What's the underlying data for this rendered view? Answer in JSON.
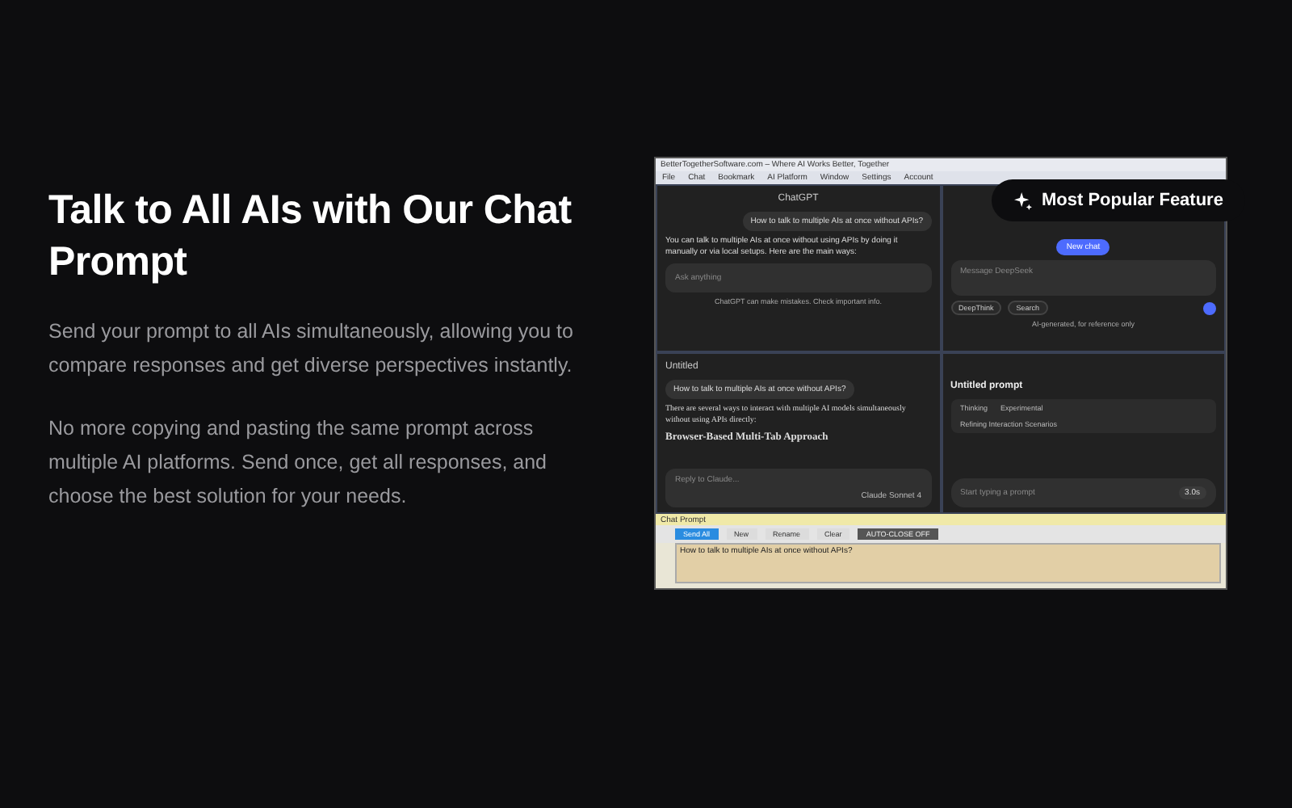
{
  "hero": {
    "title": "Talk to All AIs with Our Chat Prompt",
    "paragraphs": [
      "Send your prompt to all AIs simultaneously, allowing you to compare responses and get diverse perspectives instantly.",
      "No more copying and pasting the same prompt across multiple AI platforms. Send once, get all responses, and choose the best solution for your needs."
    ]
  },
  "badge": {
    "label": "Most Popular Feature"
  },
  "app_window": {
    "title": "BetterTogetherSoftware.com – Where AI Works Better, Together",
    "menu": [
      "File",
      "Chat",
      "Bookmark",
      "AI Platform",
      "Window",
      "Settings",
      "Account"
    ]
  },
  "chatgpt_pane": {
    "header": "ChatGPT",
    "user_message": "How to talk to multiple AIs at once without APIs?",
    "reply": "You can talk to multiple AIs at once without using APIs by doing it manually or via local setups. Here are the main ways:",
    "placeholder": "Ask anything",
    "footer": "ChatGPT can make mistakes. Check important info."
  },
  "deepseek_pane": {
    "new_chat": "New chat",
    "placeholder": "Message DeepSeek",
    "chips": [
      "DeepThink",
      "Search"
    ],
    "footer": "AI-generated, for reference only"
  },
  "claude_pane": {
    "title": "Untitled",
    "user_message": "How to talk to multiple AIs at once without APIs?",
    "reply": "There are several ways to interact with multiple AI models simultaneously without using APIs directly:",
    "heading": "Browser-Based Multi-Tab Approach",
    "placeholder": "Reply to Claude...",
    "model": "Claude Sonnet 4"
  },
  "prompt_pane": {
    "title": "Untitled prompt",
    "step": "Thinking",
    "step_note": "Experimental",
    "status": "Refining Interaction Scenarios",
    "placeholder": "Start typing a prompt",
    "run": "3.0s"
  },
  "chat_prompt": {
    "title": "Chat Prompt",
    "buttons": [
      {
        "label": "Send All",
        "selected": true
      },
      {
        "label": "New",
        "selected": false
      },
      {
        "label": "Rename",
        "selected": false
      },
      {
        "label": "Clear",
        "selected": false
      },
      {
        "label": "AUTO-CLOSE OFF",
        "selected": false
      }
    ],
    "value": "How to talk to multiple AIs at once without APIs?"
  }
}
